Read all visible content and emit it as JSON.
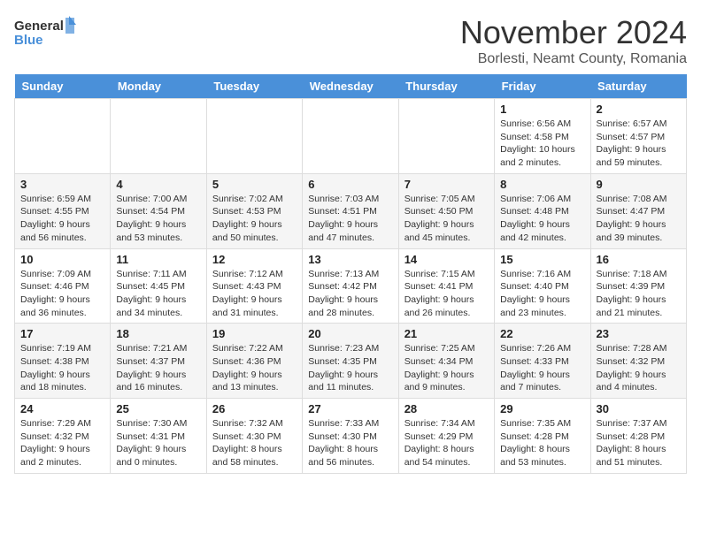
{
  "logo": {
    "line1": "General",
    "line2": "Blue"
  },
  "title": "November 2024",
  "subtitle": "Borlesti, Neamt County, Romania",
  "weekdays": [
    "Sunday",
    "Monday",
    "Tuesday",
    "Wednesday",
    "Thursday",
    "Friday",
    "Saturday"
  ],
  "weeks": [
    [
      {
        "day": "",
        "info": ""
      },
      {
        "day": "",
        "info": ""
      },
      {
        "day": "",
        "info": ""
      },
      {
        "day": "",
        "info": ""
      },
      {
        "day": "",
        "info": ""
      },
      {
        "day": "1",
        "info": "Sunrise: 6:56 AM\nSunset: 4:58 PM\nDaylight: 10 hours\nand 2 minutes."
      },
      {
        "day": "2",
        "info": "Sunrise: 6:57 AM\nSunset: 4:57 PM\nDaylight: 9 hours\nand 59 minutes."
      }
    ],
    [
      {
        "day": "3",
        "info": "Sunrise: 6:59 AM\nSunset: 4:55 PM\nDaylight: 9 hours\nand 56 minutes."
      },
      {
        "day": "4",
        "info": "Sunrise: 7:00 AM\nSunset: 4:54 PM\nDaylight: 9 hours\nand 53 minutes."
      },
      {
        "day": "5",
        "info": "Sunrise: 7:02 AM\nSunset: 4:53 PM\nDaylight: 9 hours\nand 50 minutes."
      },
      {
        "day": "6",
        "info": "Sunrise: 7:03 AM\nSunset: 4:51 PM\nDaylight: 9 hours\nand 47 minutes."
      },
      {
        "day": "7",
        "info": "Sunrise: 7:05 AM\nSunset: 4:50 PM\nDaylight: 9 hours\nand 45 minutes."
      },
      {
        "day": "8",
        "info": "Sunrise: 7:06 AM\nSunset: 4:48 PM\nDaylight: 9 hours\nand 42 minutes."
      },
      {
        "day": "9",
        "info": "Sunrise: 7:08 AM\nSunset: 4:47 PM\nDaylight: 9 hours\nand 39 minutes."
      }
    ],
    [
      {
        "day": "10",
        "info": "Sunrise: 7:09 AM\nSunset: 4:46 PM\nDaylight: 9 hours\nand 36 minutes."
      },
      {
        "day": "11",
        "info": "Sunrise: 7:11 AM\nSunset: 4:45 PM\nDaylight: 9 hours\nand 34 minutes."
      },
      {
        "day": "12",
        "info": "Sunrise: 7:12 AM\nSunset: 4:43 PM\nDaylight: 9 hours\nand 31 minutes."
      },
      {
        "day": "13",
        "info": "Sunrise: 7:13 AM\nSunset: 4:42 PM\nDaylight: 9 hours\nand 28 minutes."
      },
      {
        "day": "14",
        "info": "Sunrise: 7:15 AM\nSunset: 4:41 PM\nDaylight: 9 hours\nand 26 minutes."
      },
      {
        "day": "15",
        "info": "Sunrise: 7:16 AM\nSunset: 4:40 PM\nDaylight: 9 hours\nand 23 minutes."
      },
      {
        "day": "16",
        "info": "Sunrise: 7:18 AM\nSunset: 4:39 PM\nDaylight: 9 hours\nand 21 minutes."
      }
    ],
    [
      {
        "day": "17",
        "info": "Sunrise: 7:19 AM\nSunset: 4:38 PM\nDaylight: 9 hours\nand 18 minutes."
      },
      {
        "day": "18",
        "info": "Sunrise: 7:21 AM\nSunset: 4:37 PM\nDaylight: 9 hours\nand 16 minutes."
      },
      {
        "day": "19",
        "info": "Sunrise: 7:22 AM\nSunset: 4:36 PM\nDaylight: 9 hours\nand 13 minutes."
      },
      {
        "day": "20",
        "info": "Sunrise: 7:23 AM\nSunset: 4:35 PM\nDaylight: 9 hours\nand 11 minutes."
      },
      {
        "day": "21",
        "info": "Sunrise: 7:25 AM\nSunset: 4:34 PM\nDaylight: 9 hours\nand 9 minutes."
      },
      {
        "day": "22",
        "info": "Sunrise: 7:26 AM\nSunset: 4:33 PM\nDaylight: 9 hours\nand 7 minutes."
      },
      {
        "day": "23",
        "info": "Sunrise: 7:28 AM\nSunset: 4:32 PM\nDaylight: 9 hours\nand 4 minutes."
      }
    ],
    [
      {
        "day": "24",
        "info": "Sunrise: 7:29 AM\nSunset: 4:32 PM\nDaylight: 9 hours\nand 2 minutes."
      },
      {
        "day": "25",
        "info": "Sunrise: 7:30 AM\nSunset: 4:31 PM\nDaylight: 9 hours\nand 0 minutes."
      },
      {
        "day": "26",
        "info": "Sunrise: 7:32 AM\nSunset: 4:30 PM\nDaylight: 8 hours\nand 58 minutes."
      },
      {
        "day": "27",
        "info": "Sunrise: 7:33 AM\nSunset: 4:30 PM\nDaylight: 8 hours\nand 56 minutes."
      },
      {
        "day": "28",
        "info": "Sunrise: 7:34 AM\nSunset: 4:29 PM\nDaylight: 8 hours\nand 54 minutes."
      },
      {
        "day": "29",
        "info": "Sunrise: 7:35 AM\nSunset: 4:28 PM\nDaylight: 8 hours\nand 53 minutes."
      },
      {
        "day": "30",
        "info": "Sunrise: 7:37 AM\nSunset: 4:28 PM\nDaylight: 8 hours\nand 51 minutes."
      }
    ]
  ]
}
